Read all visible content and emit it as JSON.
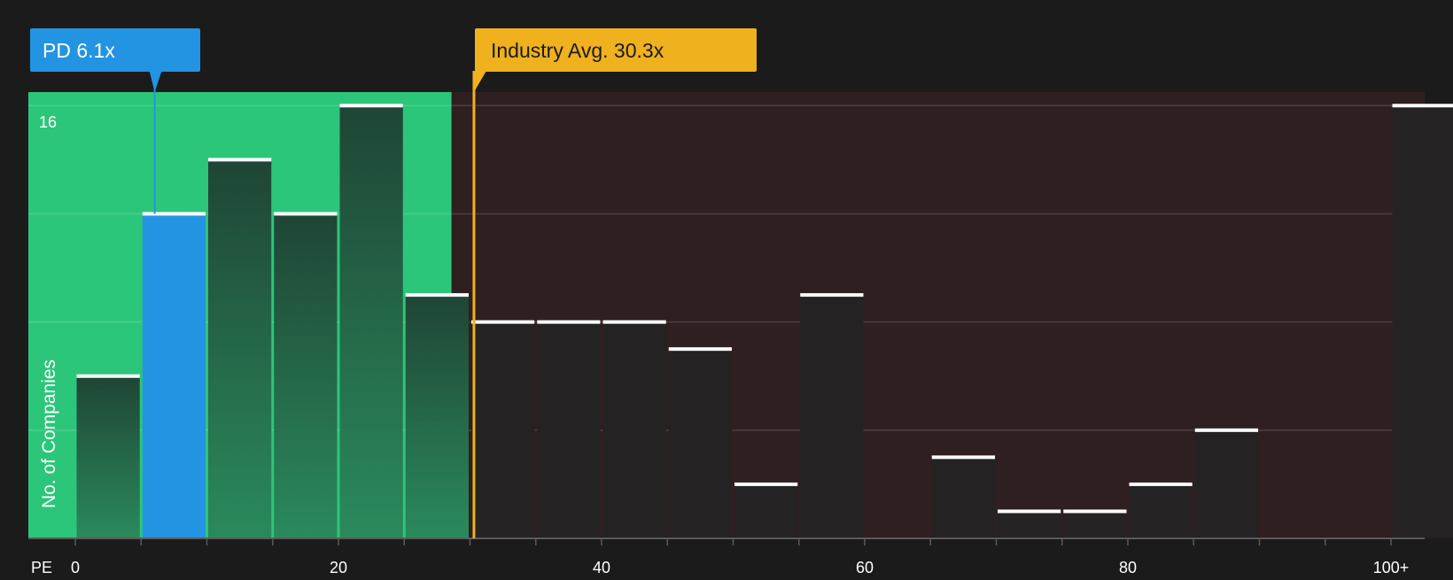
{
  "chart_data": {
    "type": "bar",
    "xlabel": "PE",
    "ylabel": "No. of Companies",
    "bin_width": 5,
    "x": [
      0,
      5,
      10,
      15,
      20,
      25,
      30,
      35,
      40,
      45,
      50,
      55,
      60,
      65,
      70,
      75,
      80,
      85,
      90,
      95,
      100
    ],
    "values": [
      6,
      12,
      14,
      12,
      16,
      9,
      8,
      8,
      8,
      7,
      2,
      9,
      0,
      3,
      1,
      1,
      2,
      4,
      0,
      0,
      16
    ],
    "xlim": [
      0,
      102
    ],
    "ylim": [
      0,
      16.5
    ],
    "x_ticks": [
      {
        "value": 0,
        "label": "0"
      },
      {
        "value": 20,
        "label": "20"
      },
      {
        "value": 40,
        "label": "40"
      },
      {
        "value": 60,
        "label": "60"
      },
      {
        "value": 80,
        "label": "80"
      },
      {
        "value": 100,
        "label": "100+"
      }
    ],
    "y_tick_label": {
      "value": 16,
      "label": "16"
    },
    "y_gridlines": [
      4,
      8,
      12,
      16
    ],
    "highlight": {
      "label": "PD 6.1x",
      "value": 6.1,
      "bin_start": 5,
      "color": "#2394e2"
    },
    "industry_avg": {
      "label": "Industry Avg. 30.3x",
      "value": 30.3,
      "color": "#efb11d"
    },
    "colors": {
      "background": "#1b1b1b",
      "below_avg_region": "#2cc67a",
      "above_avg_region": "#2f1f20",
      "bar_below": "#23473a",
      "bar_above": "#242222",
      "bar_cap": "#ffffff"
    }
  }
}
